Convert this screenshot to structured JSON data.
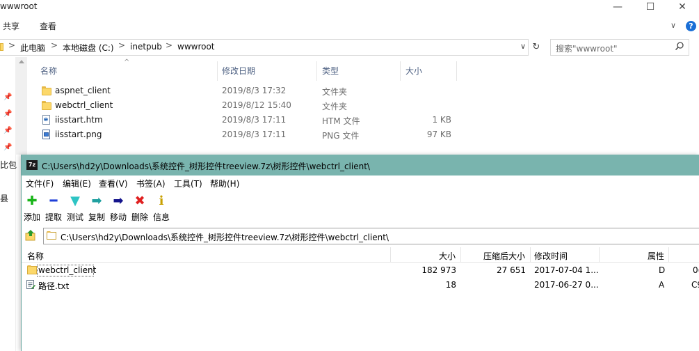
{
  "explorer": {
    "title": "wwwroot",
    "window_buttons": {
      "minimize": "—",
      "maximize": "☐",
      "close": "✕"
    },
    "ribbon_tabs": [
      "共享",
      "查看"
    ],
    "ribbon_expand": "∨",
    "help": "?",
    "address": {
      "crumbs": [
        "此电脑",
        "本地磁盘 (C:)",
        "inetpub",
        "wwwroot"
      ],
      "separator": ">",
      "dropdown": "∨",
      "refresh": "↻"
    },
    "search": {
      "placeholder": "搜索\"wwwroot\""
    },
    "side_labels": [
      "比包",
      "县"
    ],
    "columns": [
      "名称",
      "修改日期",
      "类型",
      "大小"
    ],
    "sort_indicator": "^",
    "files": [
      {
        "name": "aspnet_client",
        "date": "2019/8/3 17:32",
        "type": "文件夹",
        "size": "",
        "icon": "folder-icon"
      },
      {
        "name": "webctrl_client",
        "date": "2019/8/12 15:40",
        "type": "文件夹",
        "size": "",
        "icon": "folder-icon"
      },
      {
        "name": "iisstart.htm",
        "date": "2019/8/3 17:11",
        "type": "HTM 文件",
        "size": "1 KB",
        "icon": "htm-file-icon"
      },
      {
        "name": "iisstart.png",
        "date": "2019/8/3 17:11",
        "type": "PNG 文件",
        "size": "97 KB",
        "icon": "png-file-icon"
      }
    ]
  },
  "sevenzip": {
    "logo": "7z",
    "title": "C:\\Users\\hd2y\\Downloads\\系统控件_树形控件treeview.7z\\树形控件\\webctrl_client\\",
    "menu": [
      "文件(F)",
      "编辑(E)",
      "查看(V)",
      "书签(A)",
      "工具(T)",
      "帮助(H)"
    ],
    "toolbar": [
      {
        "label": "添加",
        "icon": "add-icon",
        "glyph": "✚",
        "color": "#19b419"
      },
      {
        "label": "提取",
        "icon": "extract-icon",
        "glyph": "━",
        "color": "#1f3fd8"
      },
      {
        "label": "测试",
        "icon": "test-icon",
        "glyph": "▼",
        "color": "#2ec4c4"
      },
      {
        "label": "复制",
        "icon": "copy-icon",
        "glyph": "➡",
        "color": "#20a0a0"
      },
      {
        "label": "移动",
        "icon": "move-icon",
        "glyph": "➡",
        "color": "#14148c"
      },
      {
        "label": "删除",
        "icon": "delete-icon",
        "glyph": "✖",
        "color": "#e02020"
      },
      {
        "label": "信息",
        "icon": "info-icon",
        "glyph": "i",
        "color": "#c8a000"
      }
    ],
    "path": "C:\\Users\\hd2y\\Downloads\\系统控件_树形控件treeview.7z\\树形控件\\webctrl_client\\",
    "columns": [
      "名称",
      "大小",
      "压缩后大小",
      "修改时间",
      "属性"
    ],
    "files": [
      {
        "name": "webctrl_client",
        "size": "182 973",
        "packed": "27 651",
        "modified": "2017-07-04 1...",
        "attr": "D",
        "extra": "0("
      },
      {
        "name": "路径.txt",
        "size": "18",
        "packed": "",
        "modified": "2017-06-27 0...",
        "attr": "A",
        "extra": "C9"
      }
    ]
  }
}
